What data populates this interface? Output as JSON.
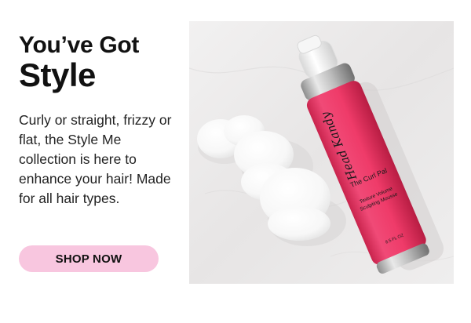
{
  "hero": {
    "eyebrow": "You’ve Got",
    "headline": "Style",
    "body": "Curly or straight, frizzy or flat, the Style Me collection is here to enhance your hair! Made for all hair types.",
    "cta_label": "SHOP NOW"
  },
  "product": {
    "brand_script": "Head Kandy",
    "name": "The Curl Pal",
    "descriptor_line1": "Texture Volume",
    "descriptor_line2": "Sculpting Mousse",
    "size": "8.5 FL OZ"
  },
  "colors": {
    "cta_background": "#f8c6df",
    "bottle_pink": "#ee3f6c",
    "text": "#111111"
  }
}
